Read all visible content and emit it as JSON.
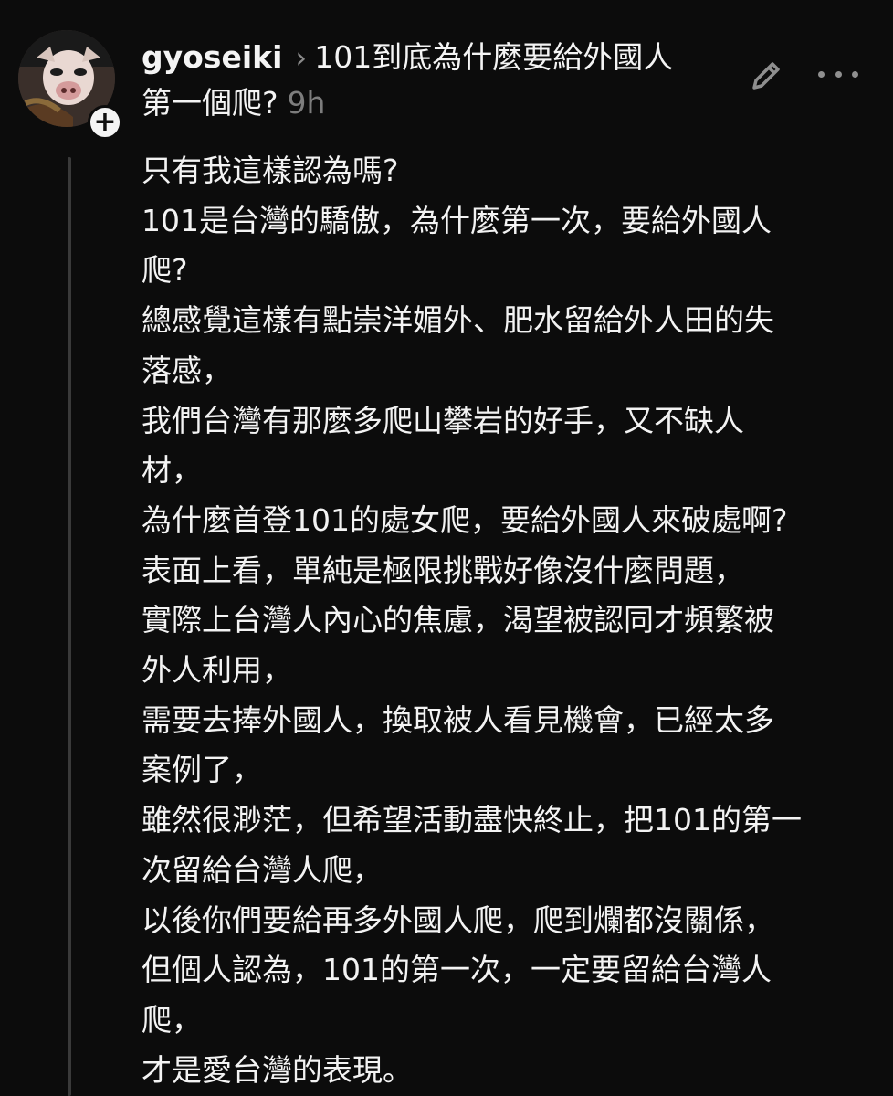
{
  "header": {
    "username": "gyoseiki",
    "chevron": "›",
    "title_line1": "101到底為什麼要給外國人",
    "title_line2": "第一個爬?",
    "time": "9h"
  },
  "actions": {
    "follow_icon": "plus-icon",
    "edit_icon": "pencil-icon",
    "more_icon": "more-dots-icon",
    "follow_symbol": "+"
  },
  "body": {
    "lines": [
      "只有我這樣認為嗎?",
      "101是台灣的驕傲，為什麼第一次，要給外國人",
      "爬?",
      "總感覺這樣有點崇洋媚外、肥水留給外人田的失",
      "落感，",
      "我們台灣有那麼多爬山攀岩的好手，又不缺人",
      "材，",
      "為什麼首登101的處女爬，要給外國人來破處啊?",
      "表面上看，單純是極限挑戰好像沒什麼問題，",
      "實際上台灣人內心的焦慮，渴望被認同才頻繁被",
      "外人利用，",
      "需要去捧外國人，換取被人看見機會，已經太多",
      "案例了，",
      "雖然很渺茫，但希望活動盡快終止，把101的第一",
      "次留給台灣人爬，",
      "以後你們要給再多外國人爬，爬到爛都沒關係，",
      "但個人認為，101的第一次，一定要留給台灣人",
      "爬，",
      "才是愛台灣的表現。"
    ]
  },
  "colors": {
    "background": "#0c0c0c",
    "text": "#f3f3f3",
    "muted": "#7d7d7d",
    "thread_line": "#3a3a3a"
  }
}
